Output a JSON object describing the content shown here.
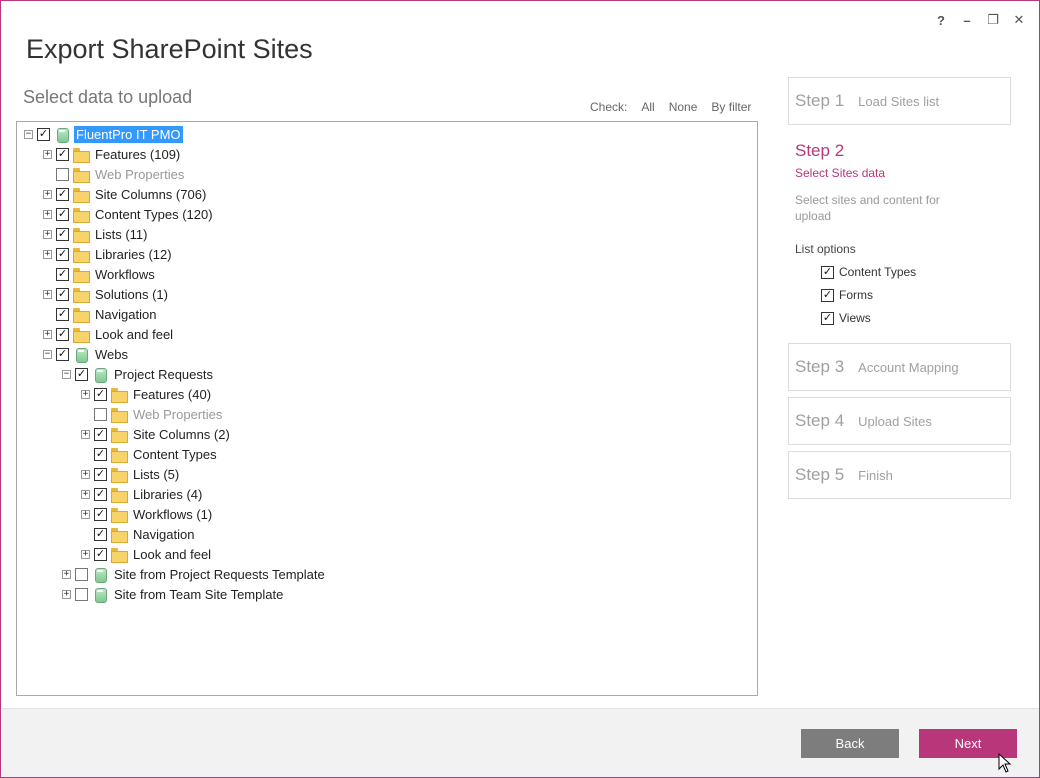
{
  "window": {
    "title": "Export SharePoint Sites",
    "controls": [
      "?",
      "–",
      "❐",
      "✕"
    ]
  },
  "main": {
    "subtitle": "Select data to upload",
    "check": {
      "label": "Check:",
      "all": "All",
      "none": "None",
      "by_filter": "By filter"
    }
  },
  "tree": [
    {
      "label": "FluentPro IT PMO",
      "level": 0,
      "icon": "site-icon",
      "checked": true,
      "expander": "minus",
      "selected": true
    },
    {
      "label": "Features (109)",
      "level": 1,
      "icon": "folder-icon",
      "checked": true,
      "expander": "plus"
    },
    {
      "label": "Web Properties",
      "level": 1,
      "icon": "folder-icon",
      "checked": false,
      "expander": "none",
      "dim": true
    },
    {
      "label": "Site Columns (706)",
      "level": 1,
      "icon": "folder-icon",
      "checked": true,
      "expander": "plus"
    },
    {
      "label": "Content Types (120)",
      "level": 1,
      "icon": "folder-icon",
      "checked": true,
      "expander": "plus"
    },
    {
      "label": "Lists (11)",
      "level": 1,
      "icon": "folder-icon",
      "checked": true,
      "expander": "plus"
    },
    {
      "label": "Libraries (12)",
      "level": 1,
      "icon": "folder-icon",
      "checked": true,
      "expander": "plus"
    },
    {
      "label": "Workflows",
      "level": 1,
      "icon": "folder-icon",
      "checked": true,
      "expander": "none"
    },
    {
      "label": "Solutions (1)",
      "level": 1,
      "icon": "folder-icon",
      "checked": true,
      "expander": "plus"
    },
    {
      "label": "Navigation",
      "level": 1,
      "icon": "folder-icon",
      "checked": true,
      "expander": "none"
    },
    {
      "label": "Look and feel",
      "level": 1,
      "icon": "folder-icon",
      "checked": true,
      "expander": "plus"
    },
    {
      "label": "Webs",
      "level": 1,
      "icon": "site-icon",
      "checked": true,
      "expander": "minus"
    },
    {
      "label": "Project Requests",
      "level": 2,
      "icon": "site-icon",
      "checked": true,
      "expander": "minus"
    },
    {
      "label": "Features (40)",
      "level": 3,
      "icon": "folder-icon",
      "checked": true,
      "expander": "plus"
    },
    {
      "label": "Web Properties",
      "level": 3,
      "icon": "folder-icon",
      "checked": false,
      "expander": "none",
      "dim": true
    },
    {
      "label": "Site Columns (2)",
      "level": 3,
      "icon": "folder-icon",
      "checked": true,
      "expander": "plus"
    },
    {
      "label": "Content Types",
      "level": 3,
      "icon": "folder-icon",
      "checked": true,
      "expander": "none"
    },
    {
      "label": "Lists (5)",
      "level": 3,
      "icon": "folder-icon",
      "checked": true,
      "expander": "plus"
    },
    {
      "label": "Libraries (4)",
      "level": 3,
      "icon": "folder-icon",
      "checked": true,
      "expander": "plus"
    },
    {
      "label": "Workflows (1)",
      "level": 3,
      "icon": "folder-icon",
      "checked": true,
      "expander": "plus"
    },
    {
      "label": "Navigation",
      "level": 3,
      "icon": "folder-icon",
      "checked": true,
      "expander": "none"
    },
    {
      "label": "Look and feel",
      "level": 3,
      "icon": "folder-icon",
      "checked": true,
      "expander": "plus"
    },
    {
      "label": "Site from Project Requests Template",
      "level": 2,
      "icon": "site-icon",
      "checked": false,
      "expander": "plus"
    },
    {
      "label": "Site from Team Site Template",
      "level": 2,
      "icon": "site-icon",
      "checked": false,
      "expander": "plus"
    }
  ],
  "steps": {
    "step1": {
      "num": "Step 1",
      "title": "Load Sites list"
    },
    "step2": {
      "num": "Step 2",
      "title": "Select Sites data",
      "desc": "Select sites and content for upload",
      "list_options_label": "List options",
      "options": [
        {
          "label": "Content Types",
          "checked": true
        },
        {
          "label": "Forms",
          "checked": true
        },
        {
          "label": "Views",
          "checked": true
        }
      ]
    },
    "step3": {
      "num": "Step 3",
      "title": "Account Mapping"
    },
    "step4": {
      "num": "Step 4",
      "title": "Upload Sites"
    },
    "step5": {
      "num": "Step 5",
      "title": "Finish"
    }
  },
  "footer": {
    "back": "Back",
    "next": "Next"
  },
  "colors": {
    "accent": "#b8367a",
    "selection": "#3399ff",
    "back_button": "#7d7d7d"
  }
}
